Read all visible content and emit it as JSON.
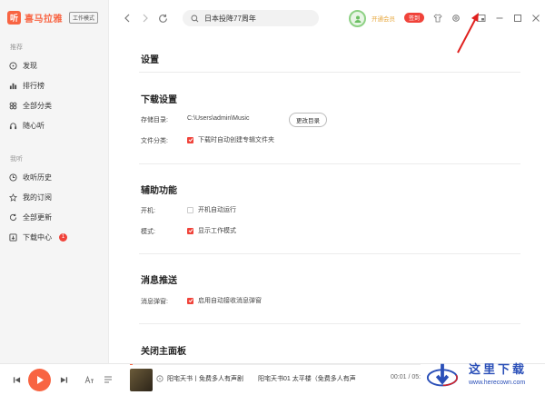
{
  "app": {
    "logo_glyph": "听",
    "name": "喜马拉雅",
    "mode_badge": "工作模式"
  },
  "sidebar": {
    "sections": [
      {
        "title": "推荐",
        "items": [
          {
            "label": "发现",
            "icon": "compass-icon"
          },
          {
            "label": "排行榜",
            "icon": "chart-icon"
          },
          {
            "label": "全部分类",
            "icon": "grid-icon"
          },
          {
            "label": "随心听",
            "icon": "headphone-icon"
          }
        ]
      },
      {
        "title": "我听",
        "items": [
          {
            "label": "收听历史",
            "icon": "clock-icon"
          },
          {
            "label": "我的订阅",
            "icon": "star-icon"
          },
          {
            "label": "全部更新",
            "icon": "refresh-icon"
          },
          {
            "label": "下载中心",
            "icon": "download-icon",
            "badge": "1"
          }
        ]
      }
    ]
  },
  "topbar": {
    "search": {
      "value": "日本投降77周年"
    },
    "vip_label": "开通会员",
    "sign_label": "签到"
  },
  "settings": {
    "title": "设置",
    "download": {
      "heading": "下载设置",
      "dir_label": "存储目录:",
      "dir_value": "C:\\Users\\admin\\Music",
      "change_dir": "更改目录",
      "category_label": "文件分类:",
      "category_check": "下载时自动创建专辑文件夹"
    },
    "assist": {
      "heading": "辅助功能",
      "startup_label": "开机:",
      "startup_check": "开机自动运行",
      "mode_label": "模式:",
      "mode_check": "显示工作模式"
    },
    "push": {
      "heading": "消息推送",
      "popup_label": "消息弹窗:",
      "popup_check": "启用自动接收消息弹窗"
    },
    "close_panel": {
      "heading": "关闭主面板"
    }
  },
  "player": {
    "track_left": "阳宅天书丨免费多人有声剧",
    "track_right": "阳宅天书01 太平楼（免费多人有声",
    "time": "00:01 / 05:",
    "progress": 0.01
  },
  "watermark": {
    "top": "这里下载",
    "bottom": "www.herecown.com"
  },
  "colors": {
    "accent": "#f86442",
    "red": "#f0433a",
    "vip": "#e7a83f"
  }
}
